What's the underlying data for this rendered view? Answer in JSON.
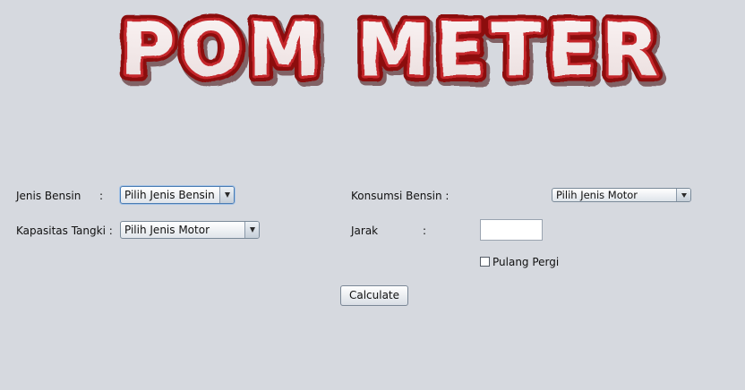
{
  "app": {
    "title": "POM METER"
  },
  "form": {
    "jenis_bensin": {
      "label": "Jenis Bensin",
      "colon": ":",
      "selected": "Pilih Jenis Bensin"
    },
    "kapasitas_tangki": {
      "label": "Kapasitas Tangki :",
      "selected": "Pilih Jenis Motor"
    },
    "konsumsi_bensin": {
      "label": "Konsumsi Bensin :",
      "selected": "Pilih Jenis Motor"
    },
    "jarak": {
      "label": "Jarak",
      "colon": ":",
      "value": ""
    },
    "pulang_pergi": {
      "label": "Pulang Pergi",
      "checked": false
    },
    "calculate_label": "Calculate"
  },
  "colors": {
    "background": "#d6d9df",
    "logo_fill": "#f4ecec",
    "logo_outline": "#8c0d10"
  }
}
